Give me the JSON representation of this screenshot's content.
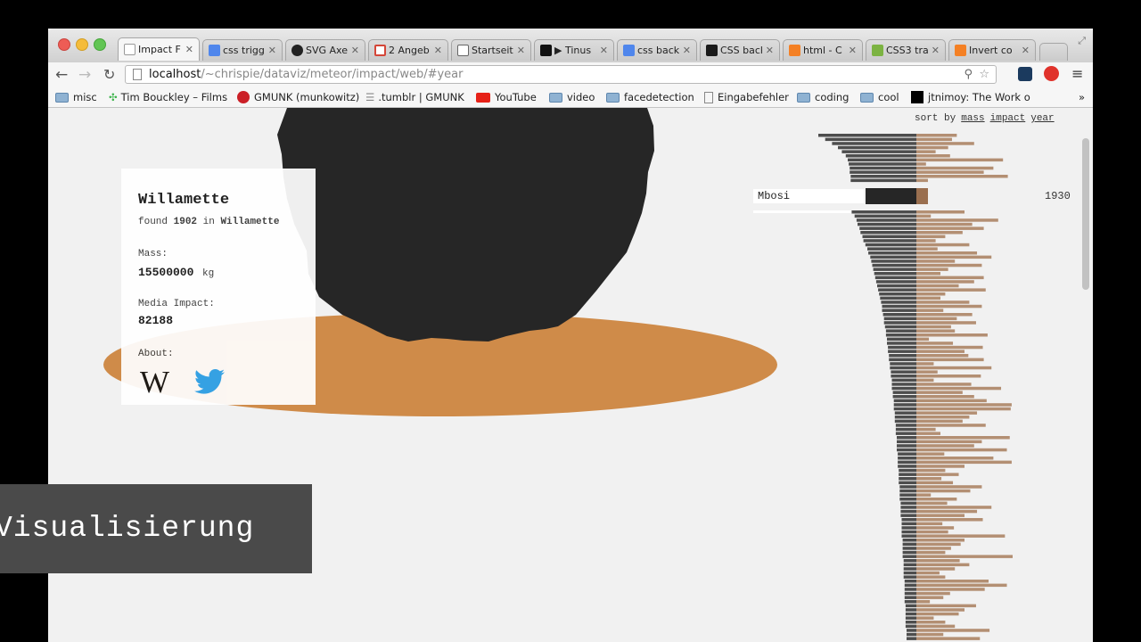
{
  "browser": {
    "tabs": [
      {
        "title": "Impact F",
        "favicon": "page-icon",
        "active": true
      },
      {
        "title": "css trigg",
        "favicon": "google-icon"
      },
      {
        "title": "SVG Axe",
        "favicon": "github-icon"
      },
      {
        "title": "2 Angeb",
        "favicon": "gmail-icon"
      },
      {
        "title": "Startseit",
        "favicon": "startpage-icon"
      },
      {
        "title": "▶ Tinus",
        "favicon": "play-icon"
      },
      {
        "title": "css back",
        "favicon": "google-icon"
      },
      {
        "title": "CSS back",
        "favicon": "css-icon"
      },
      {
        "title": "html - C",
        "favicon": "stackoverflow-icon"
      },
      {
        "title": "CSS3 tra",
        "favicon": "w3-icon"
      },
      {
        "title": "Invert co",
        "favicon": "stackoverflow-icon"
      }
    ],
    "url_host": "localhost",
    "url_path": "/~chrispie/dataviz/meteor/impact/web/#year",
    "bookmarks": [
      {
        "label": "misc",
        "icon": "folder-icon"
      },
      {
        "label": "Tim Bouckley – Films",
        "icon": "dots-icon"
      },
      {
        "label": "GMUNK (munkowitz)",
        "icon": "pinterest-icon"
      },
      {
        "label": ".tumblr | GMUNK",
        "icon": "lines-icon"
      },
      {
        "label": "YouTube",
        "icon": "youtube-icon"
      },
      {
        "label": "video",
        "icon": "folder-icon"
      },
      {
        "label": "facedetection",
        "icon": "folder-icon"
      },
      {
        "label": "Eingabefehler",
        "icon": "page-icon"
      },
      {
        "label": "coding",
        "icon": "folder-icon"
      },
      {
        "label": "cool",
        "icon": "folder-icon"
      },
      {
        "label": "jtnimoy: The Work o",
        "icon": "black-square-icon"
      }
    ],
    "bookmarks_more": "»"
  },
  "meteor": {
    "name": "Willamette",
    "found_prefix": "found",
    "year": "1902",
    "in_label": "in",
    "place": "Willamette",
    "mass_label": "Mass:",
    "mass_value": "15500000",
    "mass_unit": "kg",
    "impact_label": "Media Impact:",
    "impact_value": "82188",
    "about_label": "About:",
    "wiki_glyph": "W"
  },
  "sort": {
    "label": "sort by",
    "options": [
      "mass",
      "impact",
      "year"
    ]
  },
  "highlight": {
    "name": "Mbosi",
    "year": "1930"
  },
  "overlay": {
    "text": "Visualisierung"
  },
  "colors": {
    "rock": "#262626",
    "crater": "#cf8b49",
    "mass_bar": "#4d4d4d",
    "impact_bar": "#b38f73",
    "twitter": "#2aa3ef"
  },
  "chart_data": {
    "type": "bar",
    "sorted_by": "year",
    "series": [
      {
        "name": "mass",
        "values": [
          1.0,
          0.93,
          0.86,
          0.8,
          0.76,
          0.72,
          0.7,
          0.69,
          0.68,
          0.68,
          0.67,
          0.67,
          0.66,
          0.63,
          0.61,
          0.6,
          0.58,
          0.57,
          0.55,
          0.54,
          0.52,
          0.5,
          0.49,
          0.47,
          0.46,
          0.45,
          0.44,
          0.43,
          0.42,
          0.41,
          0.4,
          0.39,
          0.38,
          0.37,
          0.36,
          0.35,
          0.35,
          0.34,
          0.33,
          0.33,
          0.32,
          0.31,
          0.31,
          0.3,
          0.3,
          0.29,
          0.29,
          0.28,
          0.28,
          0.27,
          0.27,
          0.26,
          0.26,
          0.25,
          0.25,
          0.25,
          0.24,
          0.24,
          0.23,
          0.23,
          0.23,
          0.22,
          0.22,
          0.22,
          0.21,
          0.21,
          0.21,
          0.2,
          0.2,
          0.2,
          0.2,
          0.19,
          0.19,
          0.19,
          0.19,
          0.18,
          0.18,
          0.18,
          0.18,
          0.17,
          0.17,
          0.17,
          0.17,
          0.16,
          0.16,
          0.16,
          0.16,
          0.15,
          0.15,
          0.15,
          0.15,
          0.15,
          0.14,
          0.14,
          0.14,
          0.14,
          0.14,
          0.13,
          0.13,
          0.13,
          0.13,
          0.13,
          0.12,
          0.12,
          0.12,
          0.12,
          0.12,
          0.12,
          0.11,
          0.11,
          0.11,
          0.11,
          0.11,
          0.11,
          0.1,
          0.1,
          0.1,
          0.1,
          0.1,
          0.1,
          0.1,
          0.1,
          0.1,
          0.1,
          0.1
        ]
      },
      {
        "name": "impact",
        "values": [
          0.42,
          0.37,
          0.6,
          0.33,
          0.2,
          0.35,
          0.9,
          0.1,
          0.8,
          0.7,
          0.95,
          0.12,
          0.5,
          0.15,
          0.85,
          0.58,
          0.7,
          0.48,
          0.3,
          0.2,
          0.55,
          0.22,
          0.63,
          0.78,
          0.4,
          0.68,
          0.33,
          0.25,
          0.7,
          0.6,
          0.44,
          0.72,
          0.3,
          0.25,
          0.55,
          0.68,
          0.28,
          0.58,
          0.42,
          0.62,
          0.36,
          0.4,
          0.74,
          0.13,
          0.38,
          0.69,
          0.5,
          0.54,
          0.7,
          0.18,
          0.78,
          0.22,
          0.67,
          0.18,
          0.57,
          0.88,
          0.48,
          0.6,
          0.73,
          0.99,
          0.98,
          0.63,
          0.55,
          0.48,
          0.72,
          0.2,
          0.25,
          0.97,
          0.68,
          0.6,
          0.94,
          0.29,
          0.8,
          0.99,
          0.5,
          0.3,
          0.44,
          0.26,
          0.38,
          0.68,
          0.56,
          0.15,
          0.42,
          0.32,
          0.78,
          0.63,
          0.5,
          0.69,
          0.27,
          0.39,
          0.33,
          0.92,
          0.5,
          0.46,
          0.36,
          0.3,
          1.0,
          0.45,
          0.55,
          0.4,
          0.24,
          0.3,
          0.75,
          0.94,
          0.71,
          0.35,
          0.28,
          0.14,
          0.62,
          0.5,
          0.44,
          0.18,
          0.3,
          0.4,
          0.76,
          0.28,
          0.66,
          0.3,
          0.47,
          0.24,
          0.35,
          0.44,
          0.52,
          0.58,
          0.6,
          0.55
        ]
      }
    ]
  }
}
